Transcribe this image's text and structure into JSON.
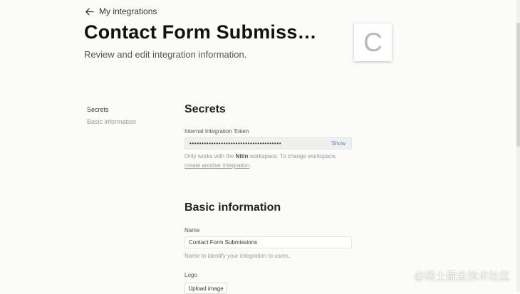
{
  "header": {
    "back_label": "My integrations",
    "title": "Contact Form Submiss…",
    "subtitle": "Review and edit integration information.",
    "logo_letter": "C"
  },
  "side_nav": {
    "items": [
      {
        "label": "Secrets",
        "active": true
      },
      {
        "label": "Basic information",
        "active": false
      }
    ]
  },
  "secrets": {
    "section_title": "Secrets",
    "token_label": "Internal Integration Token",
    "token_masked": "••••••••••••••••••••••••••••••••••••••",
    "show_label": "Show",
    "help_prefix": "Only works with the ",
    "workspace_name": "Nitin",
    "help_middle": " workspace. To change workspace,",
    "help_link": "create another integration",
    "help_suffix": "."
  },
  "basic_info": {
    "section_title": "Basic information",
    "name_label": "Name",
    "name_value": "Contact Form Submissions",
    "name_help": "Name to identify your integration to users.",
    "logo_label": "Logo",
    "upload_label": "Upload image"
  },
  "watermark": "@稀土掘金技术社区",
  "icons": {
    "back": "arrow-left-icon"
  },
  "colors": {
    "background": "#fbfbfa",
    "link_blue": "#4a90c2"
  }
}
